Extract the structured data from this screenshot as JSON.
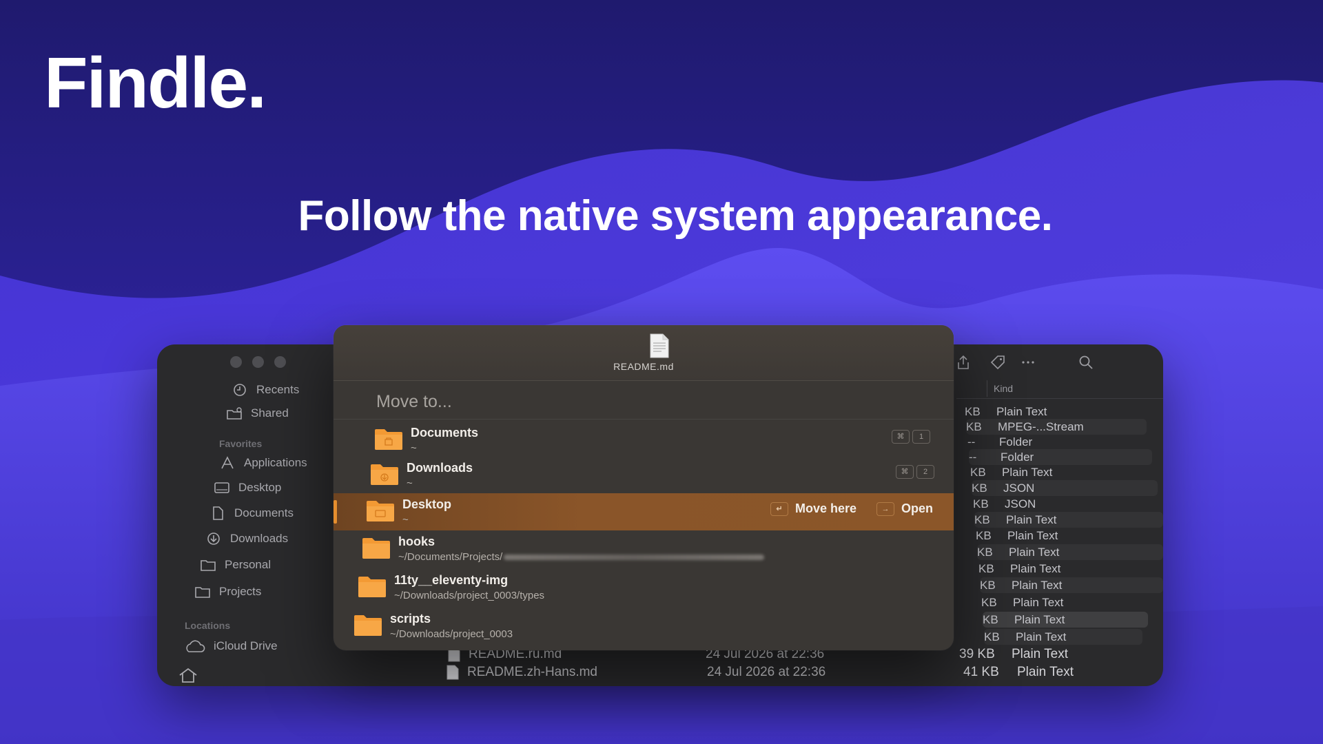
{
  "brand": "Findle.",
  "tagline": "Follow the native system appearance.",
  "colors": {
    "background": "#2a1f8f",
    "accent": "#e58e2e",
    "folder": "#f39a34",
    "selection": "#8a5529"
  },
  "finder": {
    "sidebar": {
      "items_top": [
        {
          "label": "Recents",
          "icon": "clock-icon"
        },
        {
          "label": "Shared",
          "icon": "shared-folder-icon"
        }
      ],
      "favorites_header": "Favorites",
      "favorites": [
        {
          "label": "Applications",
          "icon": "applications-icon"
        },
        {
          "label": "Desktop",
          "icon": "desktop-icon"
        },
        {
          "label": "Documents",
          "icon": "document-icon"
        },
        {
          "label": "Downloads",
          "icon": "download-icon"
        },
        {
          "label": "Personal",
          "icon": "folder-icon"
        },
        {
          "label": "Projects",
          "icon": "folder-icon"
        }
      ],
      "locations_header": "Locations",
      "locations": [
        {
          "label": "iCloud Drive",
          "icon": "cloud-icon"
        }
      ]
    },
    "list": {
      "kind_header": "Kind",
      "rows": [
        {
          "size": "KB",
          "kind": "Plain Text"
        },
        {
          "size": "KB",
          "kind": "MPEG-...Stream"
        },
        {
          "size": "--",
          "kind": "Folder"
        },
        {
          "size": "--",
          "kind": "Folder"
        },
        {
          "size": "KB",
          "kind": "Plain Text"
        },
        {
          "size": "KB",
          "kind": "JSON"
        },
        {
          "size": "KB",
          "kind": "JSON"
        },
        {
          "size": "KB",
          "kind": "Plain Text"
        },
        {
          "size": "KB",
          "kind": "Plain Text"
        },
        {
          "size": "KB",
          "kind": "Plain Text"
        },
        {
          "size": "KB",
          "kind": "Plain Text"
        },
        {
          "size": "KB",
          "kind": "Plain Text"
        },
        {
          "size": "KB",
          "kind": "Plain Text"
        },
        {
          "size": "KB",
          "kind": "Plain Text"
        },
        {
          "size": "KB",
          "kind": "Plain Text"
        }
      ],
      "files": [
        {
          "name": "README.ru.md",
          "date": "24 Jul 2026 at 22:36",
          "size": "39 KB",
          "kind": "Plain Text"
        },
        {
          "name": "README.zh-Hans.md",
          "date": "24 Jul 2026 at 22:36",
          "size": "41 KB",
          "kind": "Plain Text"
        }
      ]
    }
  },
  "panel": {
    "file_name": "README.md",
    "search_placeholder": "Move to...",
    "destinations": [
      {
        "name": "Documents",
        "path": "~",
        "key1": "⌘",
        "key2": "1"
      },
      {
        "name": "Downloads",
        "path": "~",
        "key1": "⌘",
        "key2": "2"
      },
      {
        "name": "Desktop",
        "path": "~",
        "action_move_key": "↵",
        "action_move": "Move here",
        "action_open_key": "→",
        "action_open": "Open"
      },
      {
        "name": "hooks",
        "path": "~/Documents/Projects/"
      },
      {
        "name": "11ty__eleventy-img",
        "path": "~/Downloads/project_0003/types"
      },
      {
        "name": "scripts",
        "path": "~/Downloads/project_0003"
      }
    ]
  }
}
